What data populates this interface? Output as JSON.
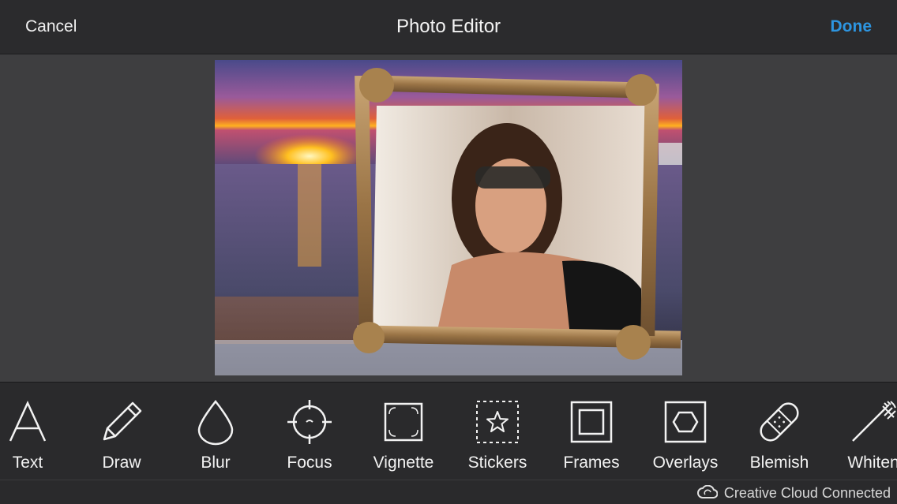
{
  "header": {
    "cancel_label": "Cancel",
    "title": "Photo Editor",
    "done_label": "Done"
  },
  "toolbar": {
    "tools": [
      {
        "label": "Text",
        "icon": "text-icon"
      },
      {
        "label": "Draw",
        "icon": "pencil-icon"
      },
      {
        "label": "Blur",
        "icon": "droplet-icon"
      },
      {
        "label": "Focus",
        "icon": "crosshair-icon"
      },
      {
        "label": "Vignette",
        "icon": "vignette-icon"
      },
      {
        "label": "Stickers",
        "icon": "star-icon"
      },
      {
        "label": "Frames",
        "icon": "frame-icon"
      },
      {
        "label": "Overlays",
        "icon": "hexagon-icon"
      },
      {
        "label": "Blemish",
        "icon": "bandage-icon"
      },
      {
        "label": "Whiten",
        "icon": "toothbrush-icon"
      }
    ]
  },
  "status": {
    "creative_cloud": "Creative Cloud Connected"
  },
  "colors": {
    "accent": "#2d95e0",
    "header_bg": "#2b2b2d",
    "toolbar_bg": "#2a2a2c"
  }
}
